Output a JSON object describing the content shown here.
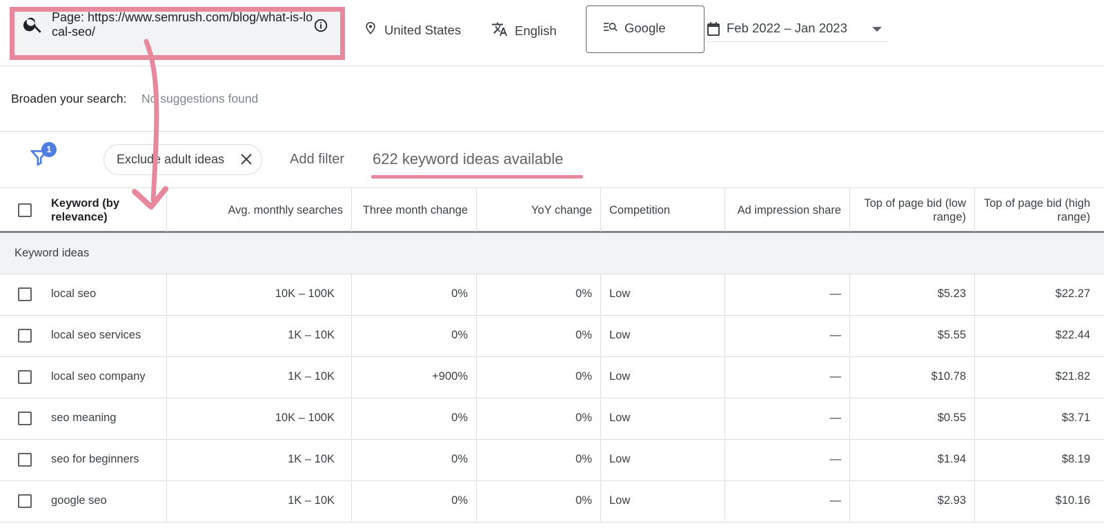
{
  "search": {
    "text": "Page: https://www.semrush.com/blog/what-is-local-seo/"
  },
  "location": "United States",
  "language": "English",
  "engine": "Google",
  "date_range": "Feb 2022 – Jan 2023",
  "broaden": {
    "label": "Broaden your search:",
    "value": "No suggestions found"
  },
  "filters": {
    "badge_count": "1",
    "chip_label": "Exclude adult ideas",
    "add_filter": "Add filter",
    "ideas_available": "622 keyword ideas available"
  },
  "table": {
    "columns": [
      "Keyword (by relevance)",
      "Avg. monthly searches",
      "Three month change",
      "YoY change",
      "Competition",
      "Ad impression share",
      "Top of page bid (low range)",
      "Top of page bid (high range)"
    ],
    "group_label": "Keyword ideas",
    "rows": [
      [
        "local seo",
        "10K – 100K",
        "0%",
        "0%",
        "Low",
        "—",
        "$5.23",
        "$22.27"
      ],
      [
        "local seo services",
        "1K – 10K",
        "0%",
        "0%",
        "Low",
        "—",
        "$5.55",
        "$22.44"
      ],
      [
        "local seo company",
        "1K – 10K",
        "+900%",
        "0%",
        "Low",
        "—",
        "$10.78",
        "$21.82"
      ],
      [
        "seo meaning",
        "10K – 100K",
        "0%",
        "0%",
        "Low",
        "—",
        "$0.55",
        "$3.71"
      ],
      [
        "seo for beginners",
        "1K – 10K",
        "0%",
        "0%",
        "Low",
        "—",
        "$1.94",
        "$8.19"
      ],
      [
        "google seo",
        "1K – 10K",
        "0%",
        "0%",
        "Low",
        "—",
        "$2.93",
        "$10.16"
      ]
    ]
  },
  "colors": {
    "highlight": "#e8889c",
    "badge": "#4f7de0"
  },
  "icons": [
    "search-icon",
    "info-icon",
    "location-pin-icon",
    "translate-icon",
    "search-engine-icon",
    "calendar-icon",
    "filter-icon",
    "close-icon",
    "annotation-arrow"
  ]
}
